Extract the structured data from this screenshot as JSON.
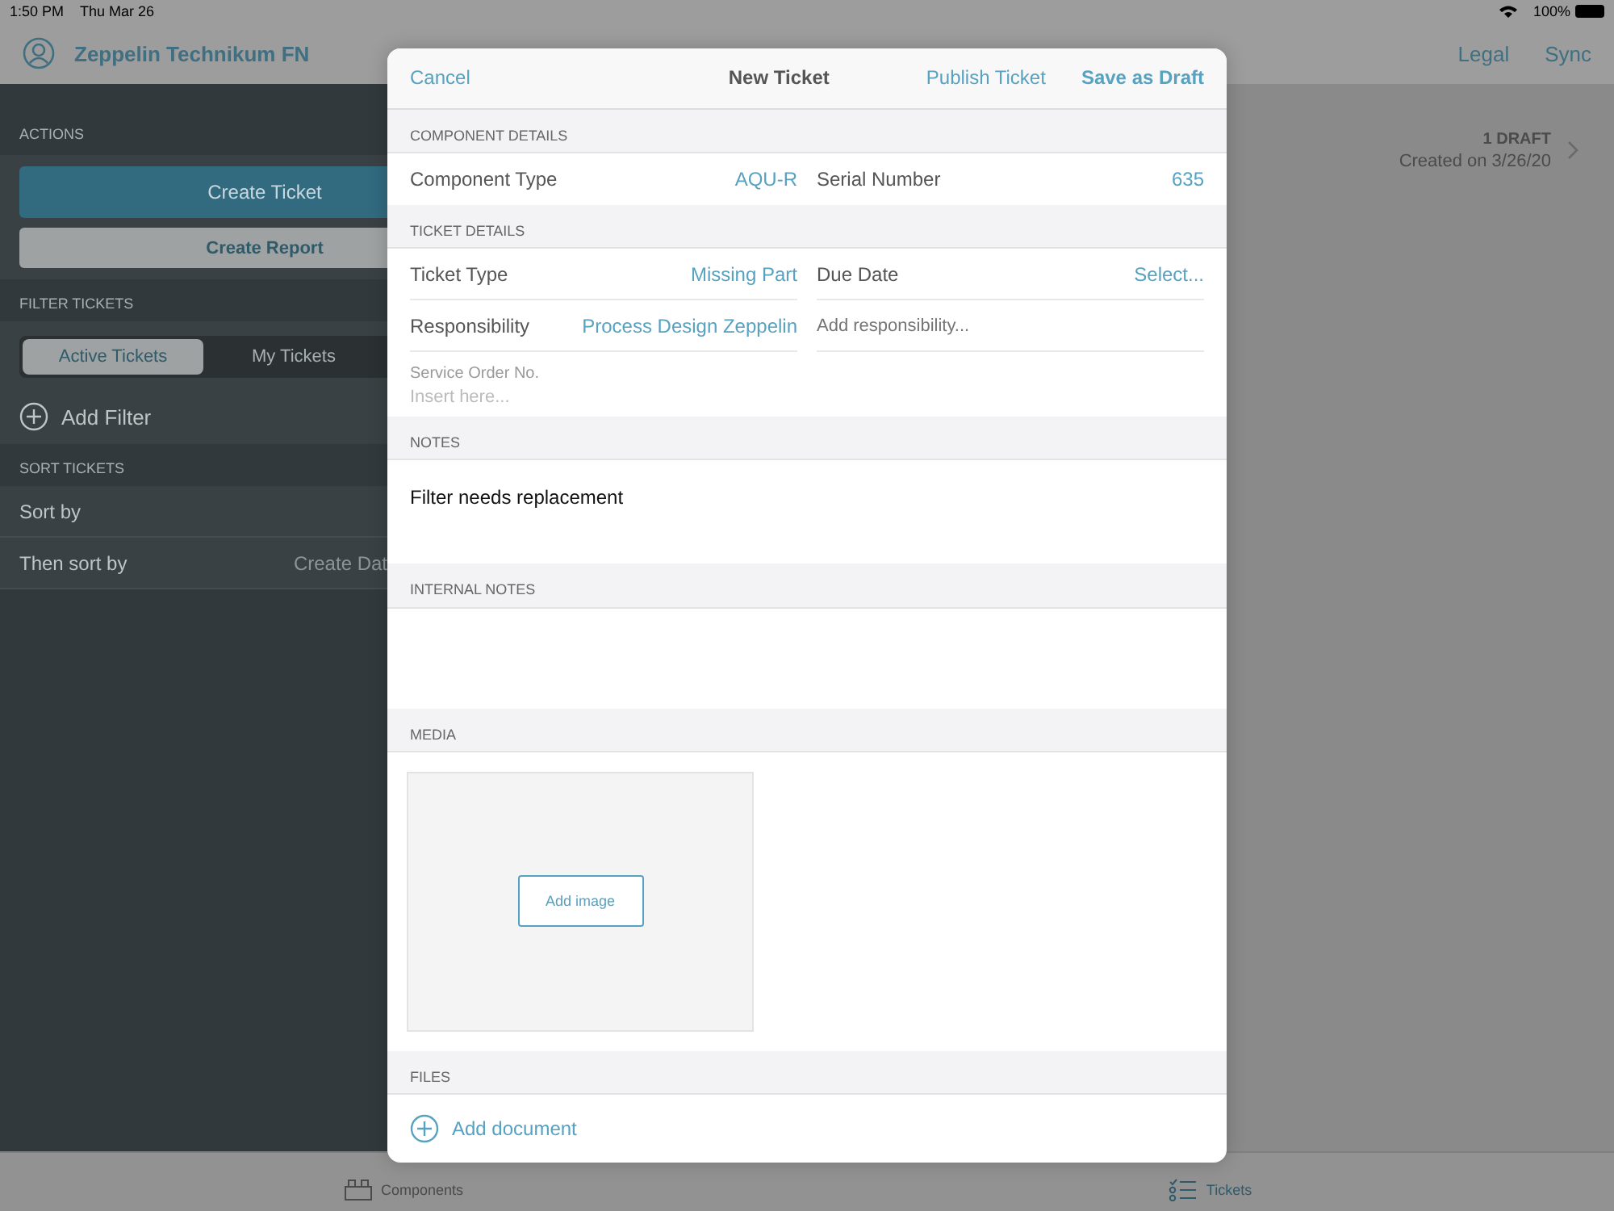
{
  "status_bar": {
    "time": "1:50 PM",
    "date": "Thu Mar 26",
    "battery": "100%"
  },
  "nav_bar": {
    "title": "Zeppelin Technikum FN",
    "actions": [
      "Legal",
      "Sync"
    ]
  },
  "sidebar": {
    "actions_header": "ACTIONS",
    "buttons": [
      {
        "label": "Create Ticket",
        "kind": "primary"
      },
      {
        "label": "Create Report",
        "kind": "secondary"
      }
    ],
    "filter_header": "FILTER TICKETS",
    "segments": [
      {
        "label": "Active Tickets",
        "selected": true
      },
      {
        "label": "My Tickets",
        "selected": false
      }
    ],
    "add_filter": "Add Filter",
    "sort_header": "SORT TICKETS",
    "sort_rows": [
      {
        "label": "Sort by"
      },
      {
        "label": "Then sort by",
        "value": "Create Dat"
      }
    ]
  },
  "drafts": {
    "count": "1 DRAFT",
    "created": "Created on 3/26/20"
  },
  "modal": {
    "cancel": "Cancel",
    "title": "New Ticket",
    "publish": "Publish Ticket",
    "save": "Save as Draft",
    "component_header": "COMPONENT DETAILS",
    "component_fields": [
      {
        "label": "Component Type",
        "value": "AQU-R"
      },
      {
        "label": "Serial Number",
        "value": "635"
      }
    ],
    "ticket_header": "TICKET DETAILS",
    "ticket_fields": [
      {
        "label": "Ticket Type",
        "value": "Missing Part"
      },
      {
        "label": "Due Date",
        "value": "Select..."
      },
      {
        "label": "Responsibility",
        "value": "Process Design Zeppelin"
      },
      {
        "placeholder": "Add responsibility..."
      }
    ],
    "service_order": {
      "label": "Service Order No.",
      "placeholder": "Insert here..."
    },
    "notes_header": "NOTES",
    "notes": "Filter needs replacement",
    "internal_header": "INTERNAL NOTES",
    "media_header": "MEDIA",
    "add_image": "Add image",
    "files_header": "FILES",
    "add_document": "Add document"
  },
  "tab_bar": [
    {
      "label": "Components",
      "selected": false,
      "kind": "components"
    },
    {
      "label": "Tickets",
      "selected": true,
      "kind": "tickets"
    }
  ]
}
